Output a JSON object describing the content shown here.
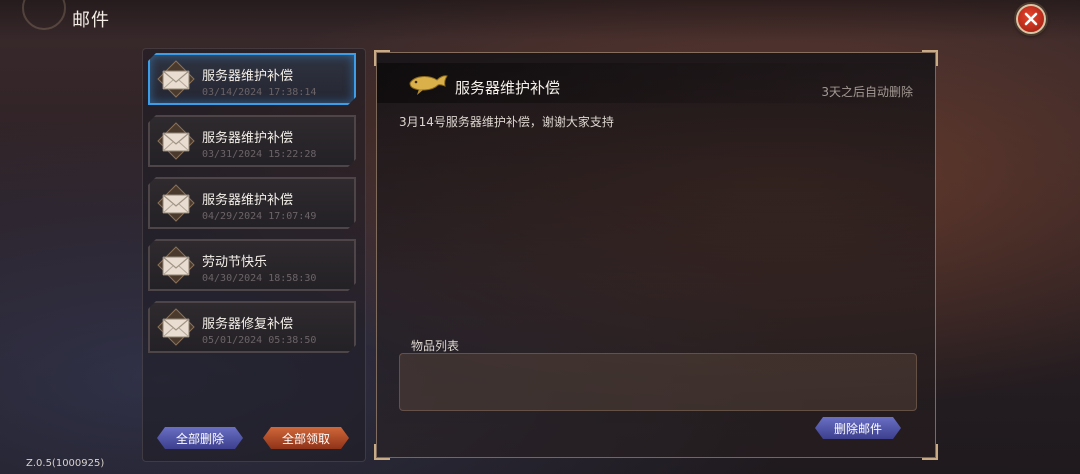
{
  "header": {
    "title": "邮件"
  },
  "mail_list": {
    "items": [
      {
        "title": "服务器维护补偿",
        "date": "03/14/2024 17:38:14",
        "selected": true
      },
      {
        "title": "服务器维护补偿",
        "date": "03/31/2024 15:22:28",
        "selected": false
      },
      {
        "title": "服务器维护补偿",
        "date": "04/29/2024 17:07:49",
        "selected": false
      },
      {
        "title": "劳动节快乐",
        "date": "04/30/2024 18:58:30",
        "selected": false
      },
      {
        "title": "服务器修复补偿",
        "date": "05/01/2024 05:38:50",
        "selected": false
      }
    ],
    "delete_all_label": "全部删除",
    "claim_all_label": "全部领取"
  },
  "detail": {
    "title": "服务器维护补偿",
    "auto_delete_note": "3天之后自动删除",
    "body": "3月14号服务器维护补偿，谢谢大家支持",
    "items_label": "物品列表",
    "delete_mail_label": "删除邮件"
  },
  "footer": {
    "version": "Z.0.5(1000925)"
  },
  "colors": {
    "selected_border": "#3c9ee8",
    "close_button": "#e8452c",
    "blue_button": "#5357a8",
    "orange_button": "#c0552a"
  },
  "icons": [
    "close-icon",
    "envelope-icon",
    "whale-icon"
  ]
}
